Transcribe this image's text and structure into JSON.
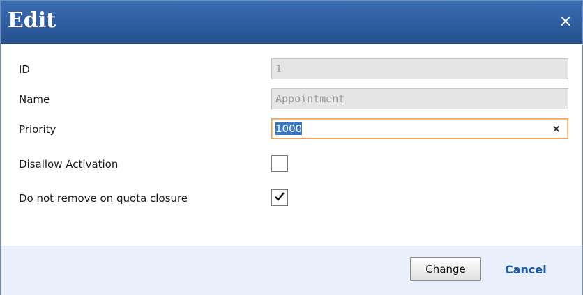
{
  "dialog": {
    "title": "Edit",
    "close_icon": "×"
  },
  "form": {
    "id_label": "ID",
    "id_value": "1",
    "name_label": "Name",
    "name_value": "Appointment",
    "priority_label": "Priority",
    "priority_value": "1000",
    "priority_clear_icon": "×",
    "disallow_label": "Disallow Activation",
    "disallow_checked": false,
    "quota_label": "Do not remove on quota closure",
    "quota_checked": true
  },
  "footer": {
    "change_label": "Change",
    "cancel_label": "Cancel"
  },
  "colors": {
    "titlebar": "#2e5d9f",
    "footer": "#e9f0fb",
    "focus_border": "#f4a460",
    "link": "#1f5aa8"
  }
}
